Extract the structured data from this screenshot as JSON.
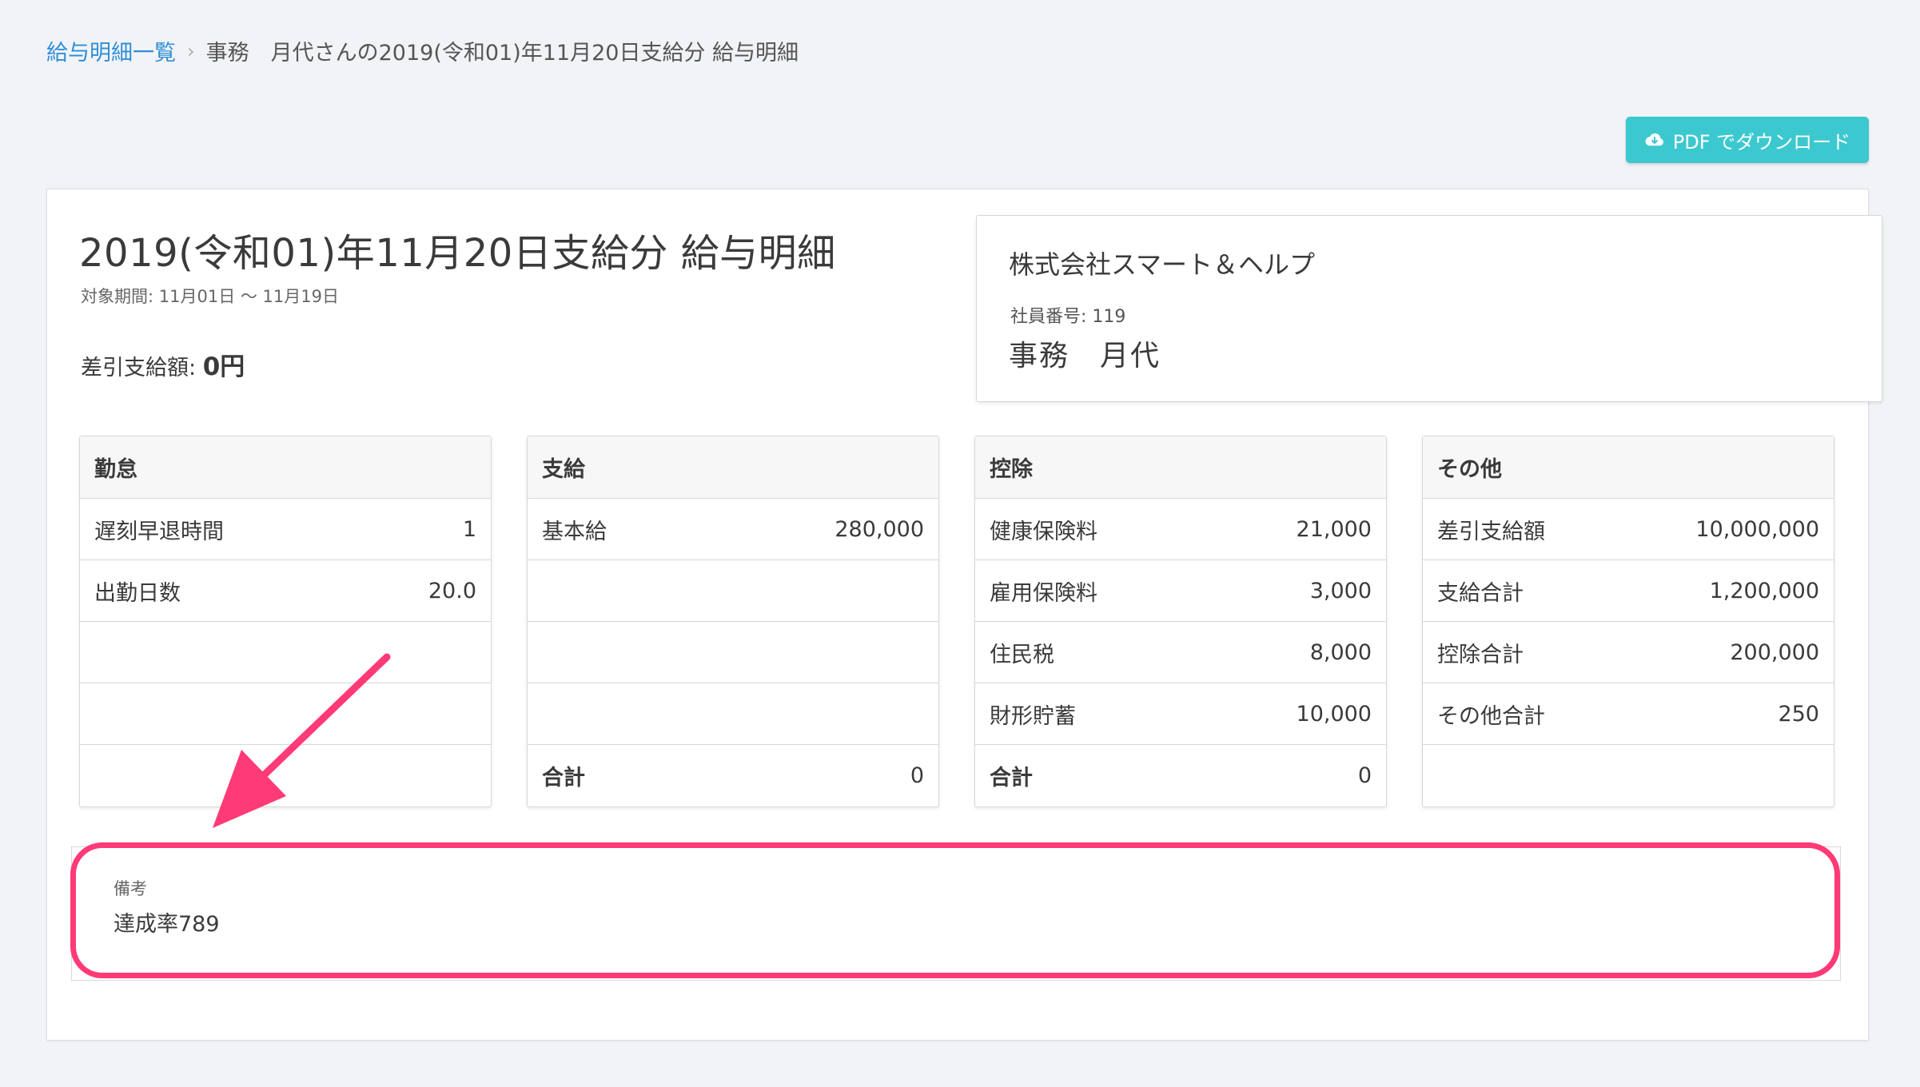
{
  "breadcrumb": {
    "link_label": "給与明細一覧",
    "separator": "›",
    "current": "事務　月代さんの2019(令和01)年11月20日支給分 給与明細"
  },
  "toolbar": {
    "pdf_button_label": "PDF でダウンロード",
    "pdf_button_icon": "cloud-download-icon",
    "accent_color": "#3cc8cf"
  },
  "payslip": {
    "title": "2019(令和01)年11月20日支給分 給与明細",
    "period": "対象期間: 11月01日 〜 11月19日",
    "net_pay_label": "差引支給額: ",
    "net_pay_amount": "0円"
  },
  "company": {
    "name": "株式会社スマート＆ヘルプ",
    "employee_number": "社員番号: 119",
    "employee_name": "事務　月代"
  },
  "sections": [
    {
      "title": "勤怠",
      "rows": [
        {
          "label": "遅刻早退時間",
          "value": "1"
        },
        {
          "label": "出勤日数",
          "value": "20.0"
        },
        {
          "label": "",
          "value": ""
        },
        {
          "label": "",
          "value": ""
        },
        {
          "label": "",
          "value": ""
        }
      ]
    },
    {
      "title": "支給",
      "rows": [
        {
          "label": "基本給",
          "value": "280,000"
        },
        {
          "label": "",
          "value": ""
        },
        {
          "label": "",
          "value": ""
        },
        {
          "label": "",
          "value": ""
        },
        {
          "label": "合計",
          "value": "0",
          "total": true
        }
      ]
    },
    {
      "title": "控除",
      "rows": [
        {
          "label": "健康保険料",
          "value": "21,000"
        },
        {
          "label": "雇用保険料",
          "value": "3,000"
        },
        {
          "label": "住民税",
          "value": "8,000"
        },
        {
          "label": "財形貯蓄",
          "value": "10,000"
        },
        {
          "label": "合計",
          "value": "0",
          "total": true
        }
      ]
    },
    {
      "title": "その他",
      "rows": [
        {
          "label": "差引支給額",
          "value": "10,000,000"
        },
        {
          "label": "支給合計",
          "value": "1,200,000"
        },
        {
          "label": "控除合計",
          "value": "200,000"
        },
        {
          "label": "その他合計",
          "value": "250"
        },
        {
          "label": "",
          "value": ""
        }
      ]
    }
  ],
  "remarks": {
    "label": "備考",
    "text": "達成率789"
  },
  "annotation": {
    "highlight_color": "#ff3a77"
  }
}
